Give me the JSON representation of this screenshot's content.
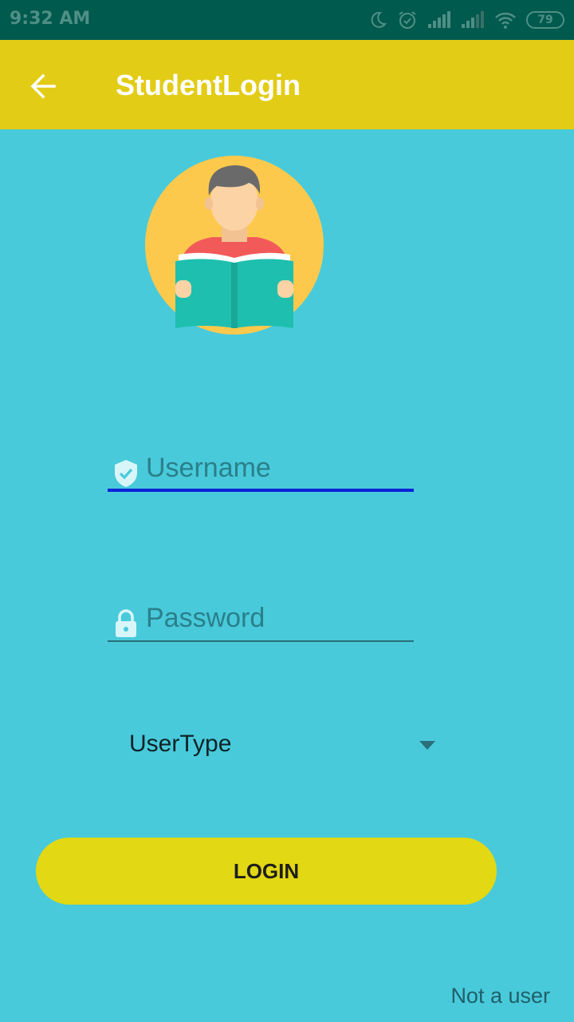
{
  "status_bar": {
    "time": "9:32 AM",
    "battery": "79",
    "icons": [
      "moon-icon",
      "alarm-icon",
      "signal-icon",
      "signal-icon",
      "wifi-icon",
      "battery-icon"
    ]
  },
  "app_bar": {
    "title": "StudentLogin",
    "back_icon": "arrow-left-icon",
    "background": "#e2cc16"
  },
  "avatar": {
    "icon": "student-reading-icon"
  },
  "form": {
    "username": {
      "value": "",
      "placeholder": "Username",
      "icon": "shield-check-icon"
    },
    "password": {
      "value": "",
      "placeholder": "Password",
      "icon": "lock-icon"
    },
    "usertype": {
      "label": "UserType",
      "icon": "dropdown-arrow-icon"
    },
    "login_label": "LOGIN"
  },
  "footer": {
    "not_user_label": "Not a user"
  },
  "colors": {
    "background": "#48cadb",
    "status_bar": "#005a4d",
    "accent_underline": "#0b22d8",
    "button": "#e2d813"
  }
}
